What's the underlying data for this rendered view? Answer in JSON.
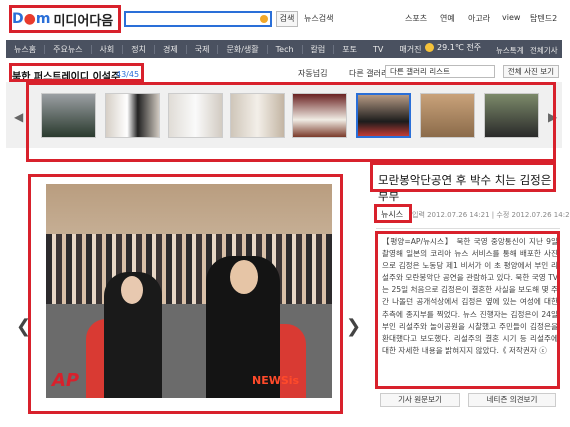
{
  "header": {
    "logo_daum": "Daum",
    "logo_korean": "미디어다음",
    "search_button": "검색",
    "news_search": "뉴스검색",
    "links": [
      "스포츠",
      "연예",
      "아고라",
      "view",
      "탑텐드2"
    ]
  },
  "nav": {
    "items": [
      "뉴스홈",
      "주요뉴스",
      "사회",
      "정치",
      "경제",
      "국제",
      "문화/생활",
      "Tech",
      "칼럼",
      "포토",
      "TV",
      "매거진"
    ],
    "weather": "29.1℃ 전주",
    "right_items": [
      "뉴스톡계",
      "전체기사"
    ]
  },
  "gallery": {
    "title": "북한 퍼스트레이디 이설주",
    "count": "43/45",
    "autoplay": "자동넘김",
    "other_gallery": "다른 갤러리",
    "select_value": "다른 갤러리 리스트",
    "view_all": "전체 사진 보기"
  },
  "photo": {
    "watermark_left": "AP",
    "watermark_right": "NEWSis"
  },
  "article": {
    "title": "모란봉악단공연 후 박수 치는 김정은 부부",
    "source": "뉴시스",
    "dates": "입력 2012.07.26 14:21 | 수정 2012.07.26 14:21",
    "body": "【평양=AP/뉴시스】 북한 국영 중앙통신이 지난 9일 촬영해 일본의 코리아 뉴스 서비스를 통해 배포한 사진으로 김정은 노동당 제1 비서가 이 초 평양에서 부인 리설주와 모란봉악단 공연을 관람하고 있다. 북한 국영 TV는 25일 처음으로 김정은이 결혼한 사실을 보도해 몇 주 간 나돌던 공개석상에서 김정은 옆에 있는 여성에 대한 추측에 종지부를 찍었다. 뉴스 진행자는 김정은이 24일 부인 리설주와 놀이공원을 시찰했고 주민들이 김정은을 환대했다고 보도했다. 리설주의 결혼 시기 등 리설주에 대한 자세한 내용을 밝혀지지 않았다.《 저작권자 ⓒ",
    "btn_original": "기사 원문보기",
    "btn_comments": "네티즌 의견보기"
  },
  "colors": {
    "highlight": "#d8212c",
    "nav_bg": "#4a5160",
    "brand_blue": "#2a6fd8"
  }
}
